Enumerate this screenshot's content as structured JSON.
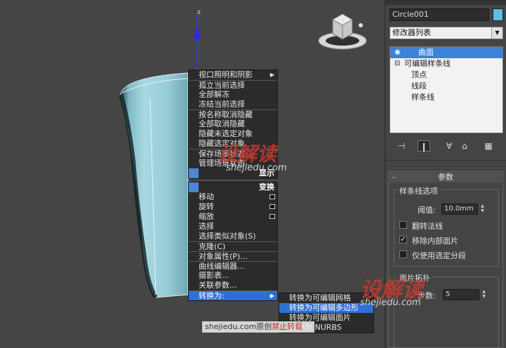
{
  "viewport": {
    "axis_label": "z"
  },
  "quad_menu": {
    "items_group1": [
      {
        "label": "视口照明和阴影",
        "arrow": true
      },
      {
        "label": "孤立当前选择"
      },
      {
        "label": "全部解冻"
      },
      {
        "label": "冻结当前选择"
      },
      {
        "label": "按名称取消隐藏"
      },
      {
        "label": "全部取消隐藏"
      },
      {
        "label": "隐藏未选定对象"
      },
      {
        "label": "隐藏选定对象"
      },
      {
        "label": "保存场景状态..."
      },
      {
        "label": "管理场景状态..."
      }
    ],
    "title_display": "显示",
    "title_transform": "变换",
    "items_group2": [
      {
        "label": "移动",
        "box": true
      },
      {
        "label": "旋转",
        "box": true
      },
      {
        "label": "缩放",
        "box": true
      },
      {
        "label": "选择"
      },
      {
        "label": "选择类似对象(S)"
      },
      {
        "label": "克隆(C)"
      },
      {
        "label": "对象属性(P)..."
      },
      {
        "label": "曲线编辑器..."
      },
      {
        "label": "摄影表..."
      },
      {
        "label": "关联参数..."
      },
      {
        "label": "转换为:",
        "arrow": true
      }
    ],
    "submenu": [
      {
        "label": "转换为可编辑网格"
      },
      {
        "label": "转换为可编辑多边形"
      },
      {
        "label": "转换为可编辑面片"
      },
      {
        "label": "转换为 NURBS"
      }
    ]
  },
  "panel": {
    "object_name": "Circle001",
    "object_color": "#5bc0e0",
    "modifier_list": "修改器列表",
    "stack": [
      {
        "label": "曲面",
        "indent": 0,
        "icon": "lightbulb"
      },
      {
        "label": "可编辑样条线",
        "indent": 0,
        "icon": "minus"
      },
      {
        "label": "顶点",
        "indent": 1
      },
      {
        "label": "线段",
        "indent": 1
      },
      {
        "label": "样条线",
        "indent": 1
      }
    ],
    "params_title": "参数",
    "spline_options_title": "样条线选项",
    "threshold_label": "阈值:",
    "threshold_value": "10.0mm",
    "flip_normals_label": "翻转法线",
    "remove_interior_label": "移除内部面片",
    "use_selected_label": "仅使用选定分段",
    "patch_topology_title": "面片拓扑",
    "steps_label": "步数:",
    "steps_value": "5"
  },
  "watermark": {
    "brand_text": "设解读",
    "url_text": "shejiedu.com",
    "footer_text": "shejiedu.com原创",
    "footer_warning": "禁止转载"
  }
}
